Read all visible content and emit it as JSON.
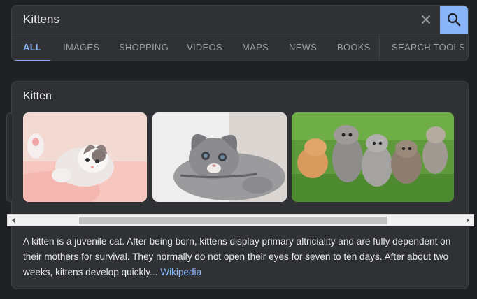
{
  "search": {
    "query": "Kittens"
  },
  "tabs": [
    {
      "label": "ALL",
      "active": true
    },
    {
      "label": "IMAGES"
    },
    {
      "label": "SHOPPING"
    },
    {
      "label": "VIDEOS"
    },
    {
      "label": "MAPS"
    },
    {
      "label": "NEWS"
    },
    {
      "label": "BOOKS"
    },
    {
      "label": "SEARCH TOOLS"
    }
  ],
  "knowledge_panel": {
    "title": "Kitten",
    "description": "A kitten is a juvenile cat. After being born, kittens display primary altriciality and are fully dependent on their mothers for survival. They normally do not open their eyes for seven to ten days. After about two weeks, kittens develop quickly...",
    "source_link": "Wikipedia"
  },
  "icons": {
    "clear": "close-icon",
    "search": "search-icon",
    "scroll_left": "arrow-left-icon",
    "scroll_right": "arrow-right-icon"
  },
  "colors": {
    "background": "#202124",
    "surface": "#303134",
    "accent": "#8ab4f8",
    "text": "#e8eaed",
    "muted_text": "#9aa0a6"
  }
}
